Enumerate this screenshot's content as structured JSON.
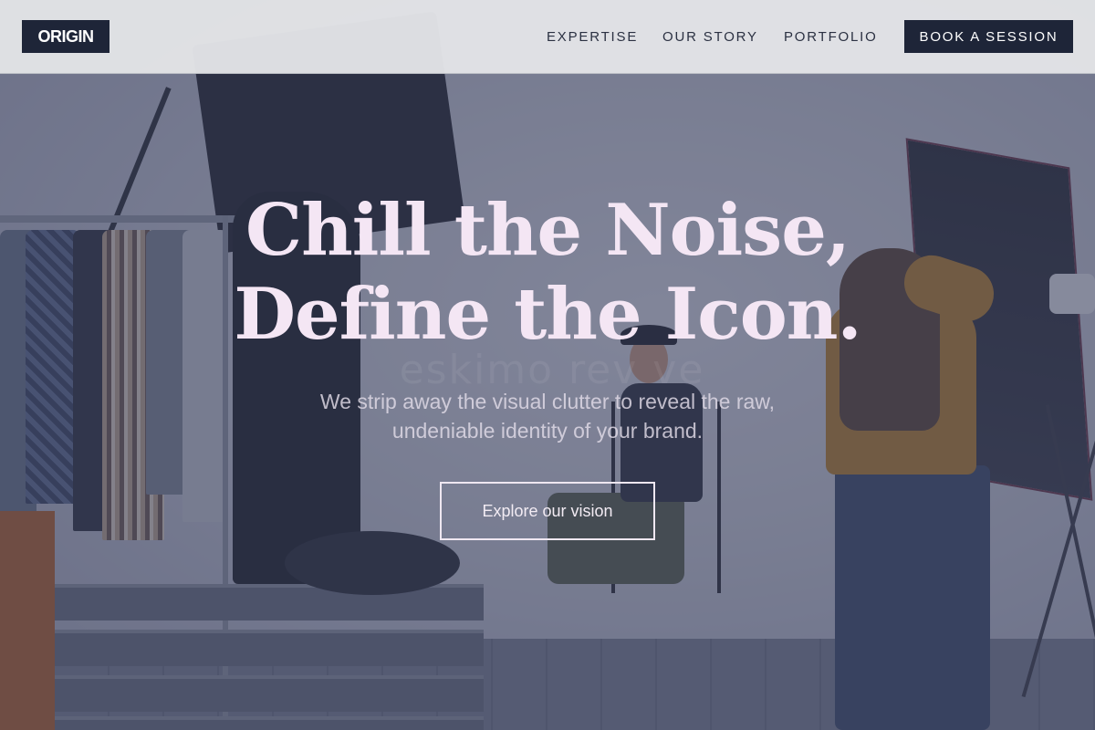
{
  "header": {
    "logo": "ORIGIN",
    "nav": [
      {
        "label": "EXPERTISE"
      },
      {
        "label": "OUR STORY"
      },
      {
        "label": "PORTFOLIO"
      }
    ],
    "cta_label": "BOOK A SESSION"
  },
  "hero": {
    "headline_line1": "Chill the Noise,",
    "headline_line2": "Define the Icon.",
    "subtitle_line1": "We strip away the visual clutter to reveal the raw,",
    "subtitle_line2": "undeniable identity of your brand.",
    "button_label": "Explore our vision",
    "watermark": "eskimo rev ve"
  },
  "colors": {
    "header_bg": "#e2e3e6",
    "brand_navy": "#1e2538",
    "headline": "#f4e6f4",
    "overlay": "#343a58"
  },
  "icons": {
    "background": "photo-studio-image"
  }
}
